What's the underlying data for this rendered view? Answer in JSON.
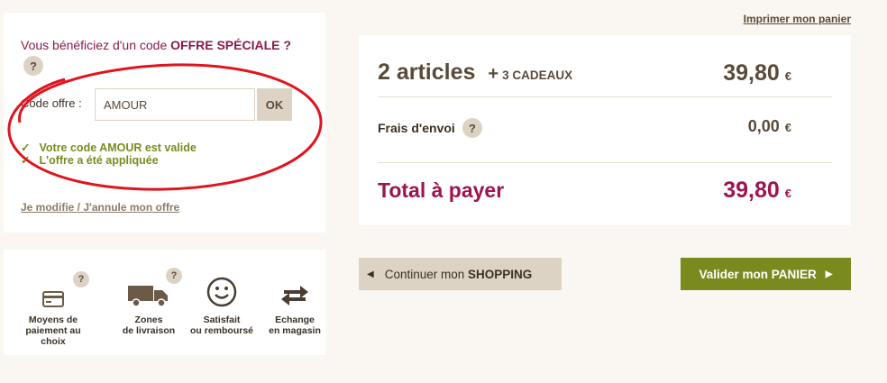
{
  "offer": {
    "title_prefix": "Vous bénéficiez d'un code ",
    "title_bold": "OFFRE SPÉCIALE ?",
    "help_badge": "?",
    "code_label": "Code offre :",
    "code_value": "AMOUR",
    "ok_label": "OK",
    "valid_messages": [
      "Votre code AMOUR est valide",
      "L'offre a été appliquée"
    ],
    "check_glyph": "✓",
    "modify_link": "Je modifie / J'annule mon offre",
    "highlight_color": "#e0141e"
  },
  "services": [
    {
      "icon": "credit-card-icon",
      "label_line1": "Moyens de",
      "label_line2": "paiement au choix",
      "help": "?"
    },
    {
      "icon": "truck-icon",
      "label_line1": "Zones",
      "label_line2": "de livraison",
      "help": "?"
    },
    {
      "icon": "smiley-icon",
      "label_line1": "Satisfait",
      "label_line2": "ou remboursé"
    },
    {
      "icon": "exchange-arrows-icon",
      "label_line1": "Echange",
      "label_line2": "en magasin"
    }
  ],
  "cart": {
    "print_link": "Imprimer mon panier",
    "articles_label": "2 articles",
    "plus": "+",
    "gifts_label": "3 CADEAUX",
    "articles_price": "39,80",
    "shipping_label": "Frais d'envoi",
    "shipping_help": "?",
    "shipping_price": "0,00",
    "total_label": "Total à payer",
    "total_price": "39,80",
    "currency": "€"
  },
  "actions": {
    "continue_prefix": "Continuer mon ",
    "continue_bold": "SHOPPING",
    "validate_prefix": "Valider mon ",
    "validate_bold": "PANIER",
    "arrow_left": "◀",
    "arrow_right": "▶"
  },
  "colors": {
    "accent_plum": "#9c1450",
    "accent_green": "#7b8a1f",
    "beige": "#ddd3c4",
    "background": "#faf6f1"
  }
}
